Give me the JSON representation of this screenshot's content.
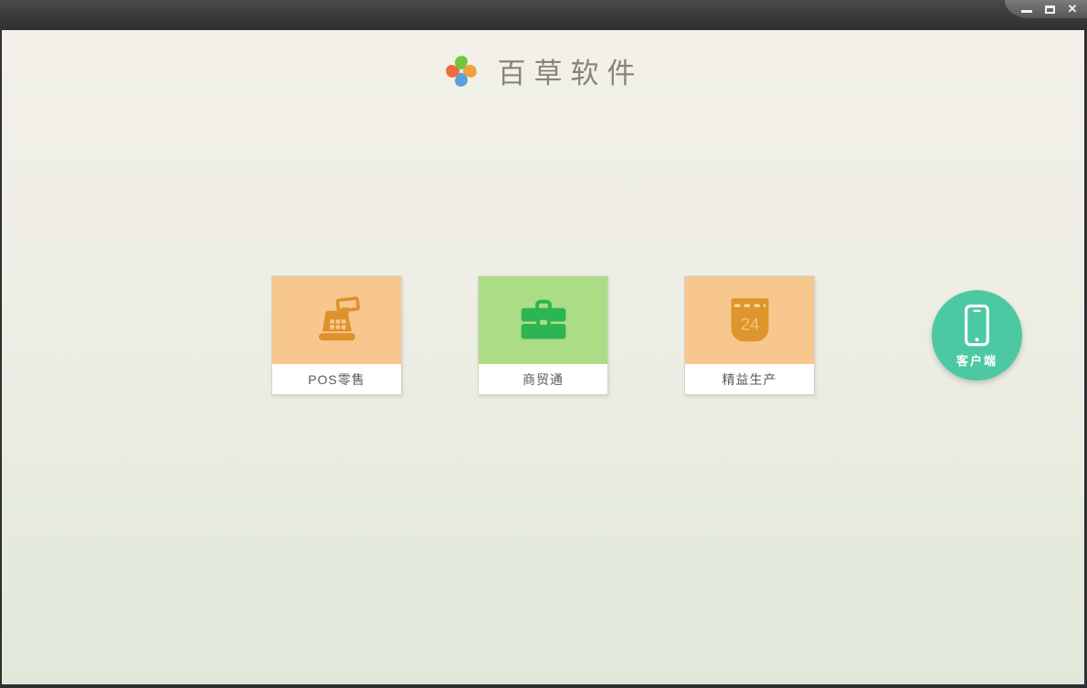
{
  "header": {
    "app_name": "百草软件",
    "logo_icon": "pinwheel-icon"
  },
  "window_controls": {
    "minimize_icon": "minimize-bar",
    "maximize_icon": "maximize-box",
    "close_glyph": "✕"
  },
  "products": [
    {
      "label": "POS零售",
      "icon": "cash-register-icon",
      "theme": "orange"
    },
    {
      "label": "商贸通",
      "icon": "briefcase-icon",
      "theme": "green"
    },
    {
      "label": "精益生产",
      "icon": "calendar-icon",
      "calendar_day": "24",
      "theme": "orange"
    }
  ],
  "client": {
    "label": "客户端",
    "icon": "smartphone-icon"
  },
  "colors": {
    "title_bar": "#3d3d3d",
    "background_top": "#f2f0e9",
    "background_bottom": "#e1e8da",
    "card_orange_bg": "#f7c78d",
    "card_orange_icon": "#de912c",
    "card_green_bg": "#abdc86",
    "card_green_icon": "#2db453",
    "client_teal": "#4cc9a2",
    "label_text": "#5a5a56",
    "logo_text": "#85857d"
  }
}
